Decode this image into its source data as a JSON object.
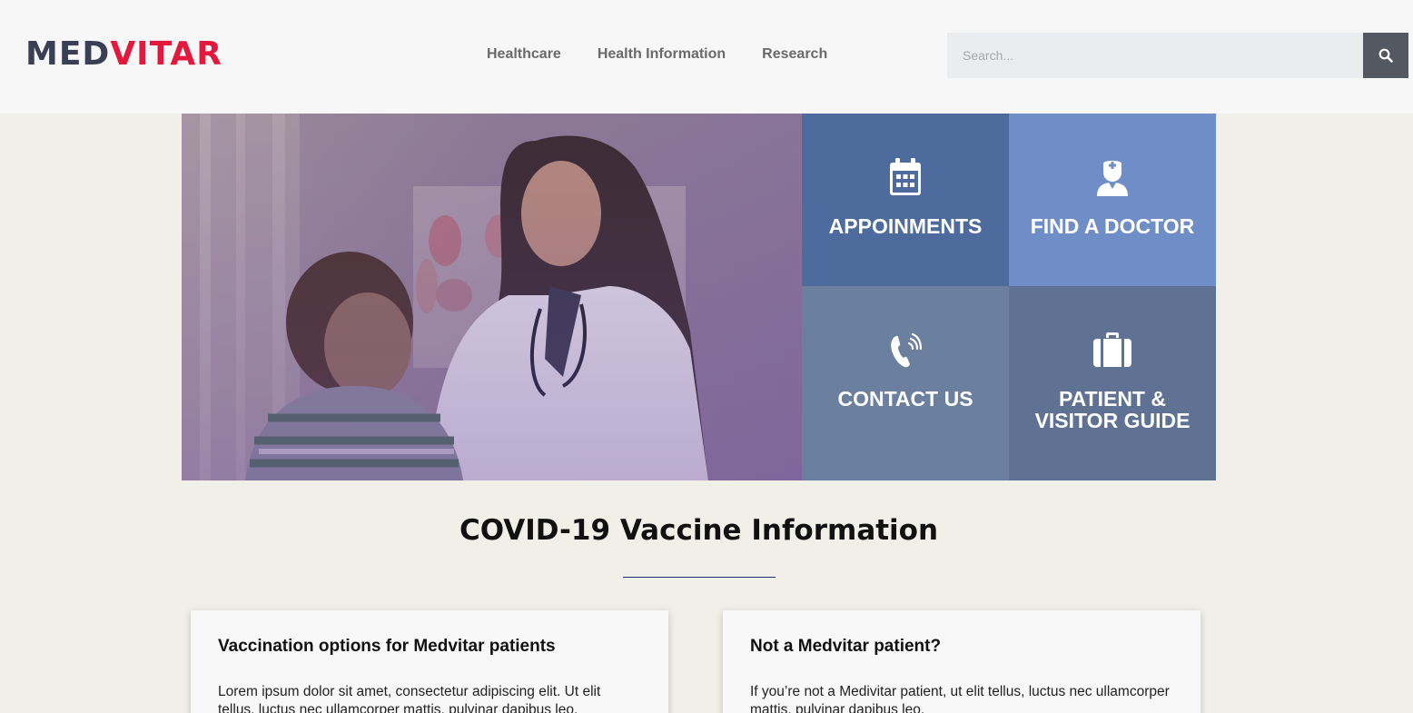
{
  "brand": {
    "logo_part1": "MED",
    "logo_part2": "VITAR",
    "colors": {
      "dark": "#3b3f55",
      "accent": "#e3183c"
    }
  },
  "nav": {
    "items": [
      "Healthcare",
      "Health Information",
      "Research"
    ]
  },
  "search": {
    "placeholder": "Search...",
    "icon": "search-icon"
  },
  "tiles": [
    {
      "label": "APPOINMENTS",
      "icon": "calendar-icon",
      "color": "#4e6b9e"
    },
    {
      "label": "FIND A DOCTOR",
      "icon": "doctor-icon",
      "color": "#6f8ec7"
    },
    {
      "label": "CONTACT US",
      "icon": "phone-icon",
      "color": "#6b7f9f"
    },
    {
      "label": "PATIENT &\nVISITOR GUIDE",
      "icon": "briefcase-icon",
      "color": "#5f7293"
    }
  ],
  "section": {
    "title": "COVID-19 Vaccine Information"
  },
  "cards": [
    {
      "title": "Vaccination options for Medvitar patients",
      "body": "Lorem ipsum dolor sit amet, consectetur adipiscing elit. Ut elit tellus, luctus nec ullamcorper mattis, pulvinar dapibus leo."
    },
    {
      "title": "Not a Medvitar patient?",
      "body": "If you’re not a Medivitar patient, ut elit tellus, luctus nec ullamcorper mattis, pulvinar dapibus leo."
    }
  ]
}
